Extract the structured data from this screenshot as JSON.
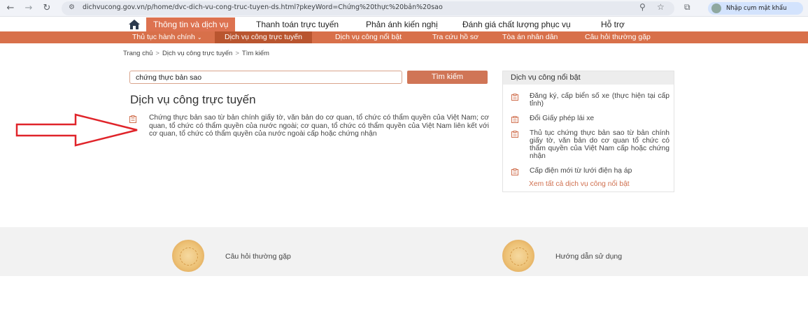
{
  "browser": {
    "url": "dichvucong.gov.vn/p/home/dvc-dich-vu-cong-truc-tuyen-ds.html?pkeyWord=Chứng%20thực%20bản%20sao",
    "profile_label": "Nhập cụm mật khẩu"
  },
  "topnav": {
    "items": [
      "Thông tin và dịch vụ",
      "Thanh toán trực tuyến",
      "Phản ánh kiến nghị",
      "Đánh giá chất lượng phục vụ",
      "Hỗ trợ"
    ]
  },
  "subnav": {
    "items": [
      "Thủ tục hành chính",
      "Dịch vụ công trực tuyến",
      "Dịch vụ công nổi bật",
      "Tra cứu hồ sơ",
      "Tòa án nhân dân",
      "Câu hỏi thường gặp"
    ]
  },
  "breadcrumb": [
    "Trang chủ",
    "Dịch vụ công trực tuyến",
    "Tìm kiếm"
  ],
  "search": {
    "value": "chứng thực bản sao",
    "button_label": "Tìm kiếm"
  },
  "main": {
    "title": "Dịch vụ công trực tuyến",
    "result": "Chứng thực bản sao từ bản chính giấy tờ, văn bản do cơ quan, tổ chức có thẩm quyền của Việt Nam; cơ quan, tổ chức có thẩm quyền của nước ngoài; cơ quan, tổ chức có thẩm quyền của Việt Nam liên kết với cơ quan, tổ chức có thẩm quyền của nước ngoài cấp hoặc chứng nhận"
  },
  "featured": {
    "title": "Dịch vụ công nổi bật",
    "items": [
      "Đăng ký, cấp biển số xe (thực hiện tại cấp tỉnh)",
      "Đổi Giấy phép lái xe",
      "Thủ tục chứng thực bản sao từ bản chính giấy tờ, văn bản do cơ quan tổ chức có thẩm quyền của Việt Nam cấp hoặc chứng nhận",
      "Cấp điện mới từ lưới điện hạ áp"
    ],
    "see_all": "Xem tất cả dịch vụ công nổi bật"
  },
  "footer": {
    "faq": "Câu hỏi thường gặp",
    "guide": "Hướng dẫn sử dụng"
  },
  "colors": {
    "accent": "#d8704a",
    "accent_dark": "#b9552f",
    "annotation_arrow": "#e0242a"
  },
  "icons": {
    "back": "arrow-left-icon",
    "forward": "arrow-right-icon",
    "reload": "reload-icon",
    "home": "home-icon",
    "document": "document-icon"
  }
}
